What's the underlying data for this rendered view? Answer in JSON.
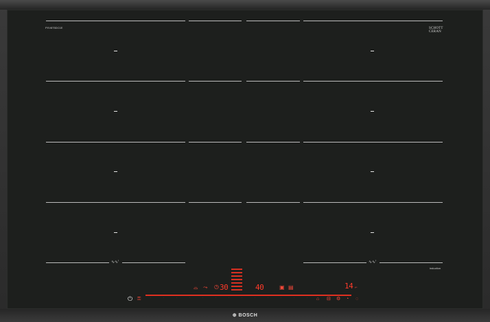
{
  "brand": "BOSCH",
  "glass_brand": [
    "SCHOTT",
    "CERAN"
  ],
  "model_code": "PXV875DC1E",
  "induction_label": "induction",
  "wave_symbol": "∿∿′",
  "displays": {
    "timer_left": "30",
    "timer_right": "40",
    "power_level": "14"
  },
  "icons": {
    "power": "power-icon",
    "lock": "lock-icon",
    "timer": "timer-icon",
    "boost": "boost-icon",
    "frying": "frying-sensor-icon",
    "move": "move-function-icon",
    "flex": "flex-zone-icon",
    "menu": "menu-icon",
    "settings": "settings-icon"
  },
  "colors": {
    "glass": "#1d1f1d",
    "display_red": "#ff3a2a",
    "frame": "#2e2e2e"
  }
}
